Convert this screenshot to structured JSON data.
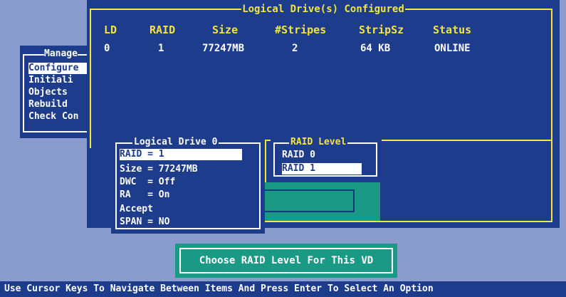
{
  "logical_drives": {
    "title": "Logical Drive(s) Configured",
    "headers": [
      "LD",
      "RAID",
      "Size",
      "#Stripes",
      "StripSz",
      "Status"
    ],
    "rows": [
      [
        "0",
        "1",
        "77247MB",
        "2",
        "64 KB",
        "ONLINE"
      ]
    ]
  },
  "management_menu": {
    "title": "Manage",
    "items": [
      "Configure",
      "Initiali",
      "Objects",
      "Rebuild",
      "Check Con"
    ]
  },
  "logical_drive_panel": {
    "title": "Logical Drive 0",
    "items": [
      "RAID = 1",
      "Size = 77247MB",
      "DWC  = Off",
      "RA   = On",
      "Accept",
      "SPAN = NO"
    ],
    "selected_index": 0
  },
  "raid_level_menu": {
    "title": "RAID Level",
    "options": [
      "RAID 0",
      "RAID 1"
    ],
    "selected_index": 1
  },
  "prompt": "Choose RAID Level For This VD",
  "status_bar": "Use Cursor Keys To Navigate Between Items And Press Enter To Select An Option",
  "colors": {
    "background": "#8a9ccd",
    "panel": "#1e3c8c",
    "frame_yellow": "#f2e63a",
    "teal": "#1a9a84",
    "highlight": "#ffffff"
  }
}
